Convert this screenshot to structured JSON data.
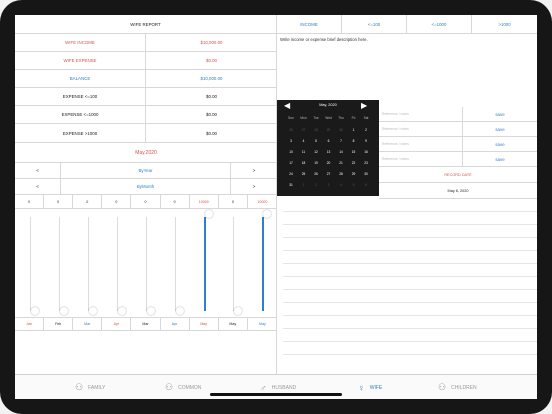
{
  "report": {
    "title": "WIFE REPORT",
    "rows": [
      {
        "label": "WIFE INCOME",
        "value": "$10,000.00",
        "color": "red"
      },
      {
        "label": "WIFE EXPENSE",
        "value": "$0.00",
        "color": "red"
      },
      {
        "label": "BALANCE",
        "value": "$10,000.00",
        "color": "blue"
      },
      {
        "label": "EXPENSE <=100",
        "value": "$0.00",
        "color": "dark"
      },
      {
        "label": "EXPENSE <=1000",
        "value": "$0.00",
        "color": "dark"
      },
      {
        "label": "EXPENSE >1000",
        "value": "$0.00",
        "color": "dark"
      }
    ],
    "period": "May,2020"
  },
  "nav": {
    "prev": "<",
    "next": ">",
    "by_year": "ByYear",
    "by_month": "ByMonth"
  },
  "sliders": {
    "labels": [
      "0",
      "0",
      "0",
      "0",
      "0",
      "0",
      "10000",
      "0",
      "10000"
    ],
    "levels": [
      0,
      0,
      0,
      0,
      0,
      0,
      1,
      0,
      1
    ],
    "months": [
      "Jan",
      "Feb",
      "Mar",
      "Apr",
      "Mar",
      "Apr",
      "May",
      "May",
      "May"
    ]
  },
  "filters": {
    "tabs": [
      "INCOME",
      "<=100",
      "<=1000",
      ">1000"
    ]
  },
  "description": {
    "placeholder": "Write income or expense brief description here."
  },
  "calendar": {
    "month": "May, 2020",
    "weekdays": [
      "Sun",
      "Mon",
      "Tue",
      "Wed",
      "Thu",
      "Fri",
      "Sat"
    ],
    "weeks": [
      [
        "26",
        "27",
        "28",
        "29",
        "30",
        "1",
        "2"
      ],
      [
        "3",
        "4",
        "5",
        "6",
        "7",
        "8",
        "9"
      ],
      [
        "10",
        "11",
        "12",
        "13",
        "14",
        "15",
        "16"
      ],
      [
        "17",
        "18",
        "19",
        "20",
        "21",
        "22",
        "23"
      ],
      [
        "24",
        "25",
        "26",
        "27",
        "28",
        "29",
        "30"
      ],
      [
        "31",
        "1",
        "2",
        "3",
        "4",
        "5",
        "6"
      ]
    ]
  },
  "entries": {
    "rows": [
      {
        "placeholder": "Reference / notes",
        "action": "save"
      },
      {
        "placeholder": "Reference / notes",
        "action": "save"
      },
      {
        "placeholder": "Reference / notes",
        "action": "save"
      },
      {
        "placeholder": "Reference / notes",
        "action": "save"
      }
    ],
    "record_date": "RECORD DATE",
    "date_value": "May 6, 2020"
  },
  "tabbar": {
    "items": [
      {
        "label": "FAMILY",
        "icon": "family-icon"
      },
      {
        "label": "COMMON",
        "icon": "common-icon"
      },
      {
        "label": "HUSBAND",
        "icon": "husband-icon"
      },
      {
        "label": "WIFE",
        "icon": "wife-icon",
        "active": true
      },
      {
        "label": "CHILDREN",
        "icon": "children-icon"
      }
    ]
  },
  "colors": {
    "accent": "#2f7fcf",
    "red": "#d9534f",
    "grid": "#d8d8d8"
  }
}
